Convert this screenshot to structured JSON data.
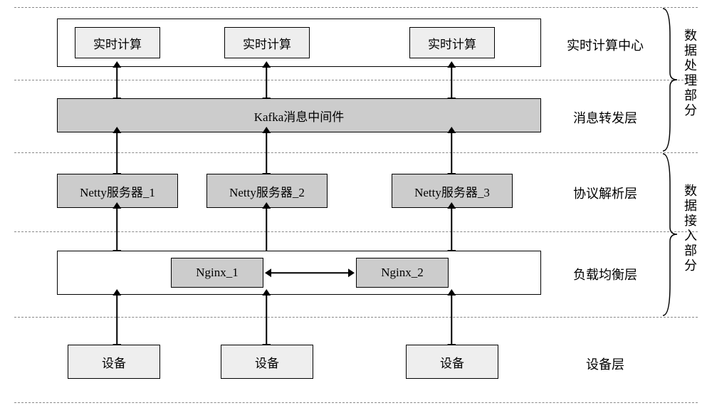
{
  "layers": {
    "realtime_center": {
      "label": "实时计算中心",
      "items": [
        "实时计算",
        "实时计算",
        "实时计算"
      ]
    },
    "message_forward": {
      "label": "消息转发层",
      "item": "Kafka消息中间件"
    },
    "protocol_parse": {
      "label": "协议解析层",
      "items": [
        "Netty服务器_1",
        "Netty服务器_2",
        "Netty服务器_3"
      ]
    },
    "load_balance": {
      "label": "负载均衡层",
      "items": [
        "Nginx_1",
        "Nginx_2"
      ]
    },
    "device": {
      "label": "设备层",
      "items": [
        "设备",
        "设备",
        "设备"
      ]
    }
  },
  "sections": {
    "data_processing": "数据处理部分",
    "data_access": "数据接入部分"
  }
}
